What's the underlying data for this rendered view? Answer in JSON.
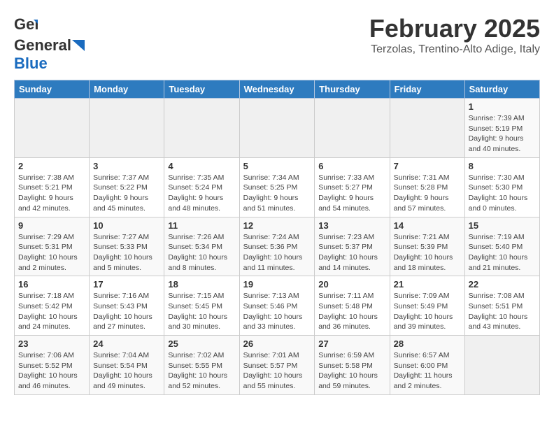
{
  "header": {
    "logo_general": "General",
    "logo_blue": "Blue",
    "title": "February 2025",
    "subtitle": "Terzolas, Trentino-Alto Adige, Italy"
  },
  "days_of_week": [
    "Sunday",
    "Monday",
    "Tuesday",
    "Wednesday",
    "Thursday",
    "Friday",
    "Saturday"
  ],
  "weeks": [
    [
      {
        "day": "",
        "info": ""
      },
      {
        "day": "",
        "info": ""
      },
      {
        "day": "",
        "info": ""
      },
      {
        "day": "",
        "info": ""
      },
      {
        "day": "",
        "info": ""
      },
      {
        "day": "",
        "info": ""
      },
      {
        "day": "1",
        "info": "Sunrise: 7:39 AM\nSunset: 5:19 PM\nDaylight: 9 hours and 40 minutes."
      }
    ],
    [
      {
        "day": "2",
        "info": "Sunrise: 7:38 AM\nSunset: 5:21 PM\nDaylight: 9 hours and 42 minutes."
      },
      {
        "day": "3",
        "info": "Sunrise: 7:37 AM\nSunset: 5:22 PM\nDaylight: 9 hours and 45 minutes."
      },
      {
        "day": "4",
        "info": "Sunrise: 7:35 AM\nSunset: 5:24 PM\nDaylight: 9 hours and 48 minutes."
      },
      {
        "day": "5",
        "info": "Sunrise: 7:34 AM\nSunset: 5:25 PM\nDaylight: 9 hours and 51 minutes."
      },
      {
        "day": "6",
        "info": "Sunrise: 7:33 AM\nSunset: 5:27 PM\nDaylight: 9 hours and 54 minutes."
      },
      {
        "day": "7",
        "info": "Sunrise: 7:31 AM\nSunset: 5:28 PM\nDaylight: 9 hours and 57 minutes."
      },
      {
        "day": "8",
        "info": "Sunrise: 7:30 AM\nSunset: 5:30 PM\nDaylight: 10 hours and 0 minutes."
      }
    ],
    [
      {
        "day": "9",
        "info": "Sunrise: 7:29 AM\nSunset: 5:31 PM\nDaylight: 10 hours and 2 minutes."
      },
      {
        "day": "10",
        "info": "Sunrise: 7:27 AM\nSunset: 5:33 PM\nDaylight: 10 hours and 5 minutes."
      },
      {
        "day": "11",
        "info": "Sunrise: 7:26 AM\nSunset: 5:34 PM\nDaylight: 10 hours and 8 minutes."
      },
      {
        "day": "12",
        "info": "Sunrise: 7:24 AM\nSunset: 5:36 PM\nDaylight: 10 hours and 11 minutes."
      },
      {
        "day": "13",
        "info": "Sunrise: 7:23 AM\nSunset: 5:37 PM\nDaylight: 10 hours and 14 minutes."
      },
      {
        "day": "14",
        "info": "Sunrise: 7:21 AM\nSunset: 5:39 PM\nDaylight: 10 hours and 18 minutes."
      },
      {
        "day": "15",
        "info": "Sunrise: 7:19 AM\nSunset: 5:40 PM\nDaylight: 10 hours and 21 minutes."
      }
    ],
    [
      {
        "day": "16",
        "info": "Sunrise: 7:18 AM\nSunset: 5:42 PM\nDaylight: 10 hours and 24 minutes."
      },
      {
        "day": "17",
        "info": "Sunrise: 7:16 AM\nSunset: 5:43 PM\nDaylight: 10 hours and 27 minutes."
      },
      {
        "day": "18",
        "info": "Sunrise: 7:15 AM\nSunset: 5:45 PM\nDaylight: 10 hours and 30 minutes."
      },
      {
        "day": "19",
        "info": "Sunrise: 7:13 AM\nSunset: 5:46 PM\nDaylight: 10 hours and 33 minutes."
      },
      {
        "day": "20",
        "info": "Sunrise: 7:11 AM\nSunset: 5:48 PM\nDaylight: 10 hours and 36 minutes."
      },
      {
        "day": "21",
        "info": "Sunrise: 7:09 AM\nSunset: 5:49 PM\nDaylight: 10 hours and 39 minutes."
      },
      {
        "day": "22",
        "info": "Sunrise: 7:08 AM\nSunset: 5:51 PM\nDaylight: 10 hours and 43 minutes."
      }
    ],
    [
      {
        "day": "23",
        "info": "Sunrise: 7:06 AM\nSunset: 5:52 PM\nDaylight: 10 hours and 46 minutes."
      },
      {
        "day": "24",
        "info": "Sunrise: 7:04 AM\nSunset: 5:54 PM\nDaylight: 10 hours and 49 minutes."
      },
      {
        "day": "25",
        "info": "Sunrise: 7:02 AM\nSunset: 5:55 PM\nDaylight: 10 hours and 52 minutes."
      },
      {
        "day": "26",
        "info": "Sunrise: 7:01 AM\nSunset: 5:57 PM\nDaylight: 10 hours and 55 minutes."
      },
      {
        "day": "27",
        "info": "Sunrise: 6:59 AM\nSunset: 5:58 PM\nDaylight: 10 hours and 59 minutes."
      },
      {
        "day": "28",
        "info": "Sunrise: 6:57 AM\nSunset: 6:00 PM\nDaylight: 11 hours and 2 minutes."
      },
      {
        "day": "",
        "info": ""
      }
    ]
  ]
}
